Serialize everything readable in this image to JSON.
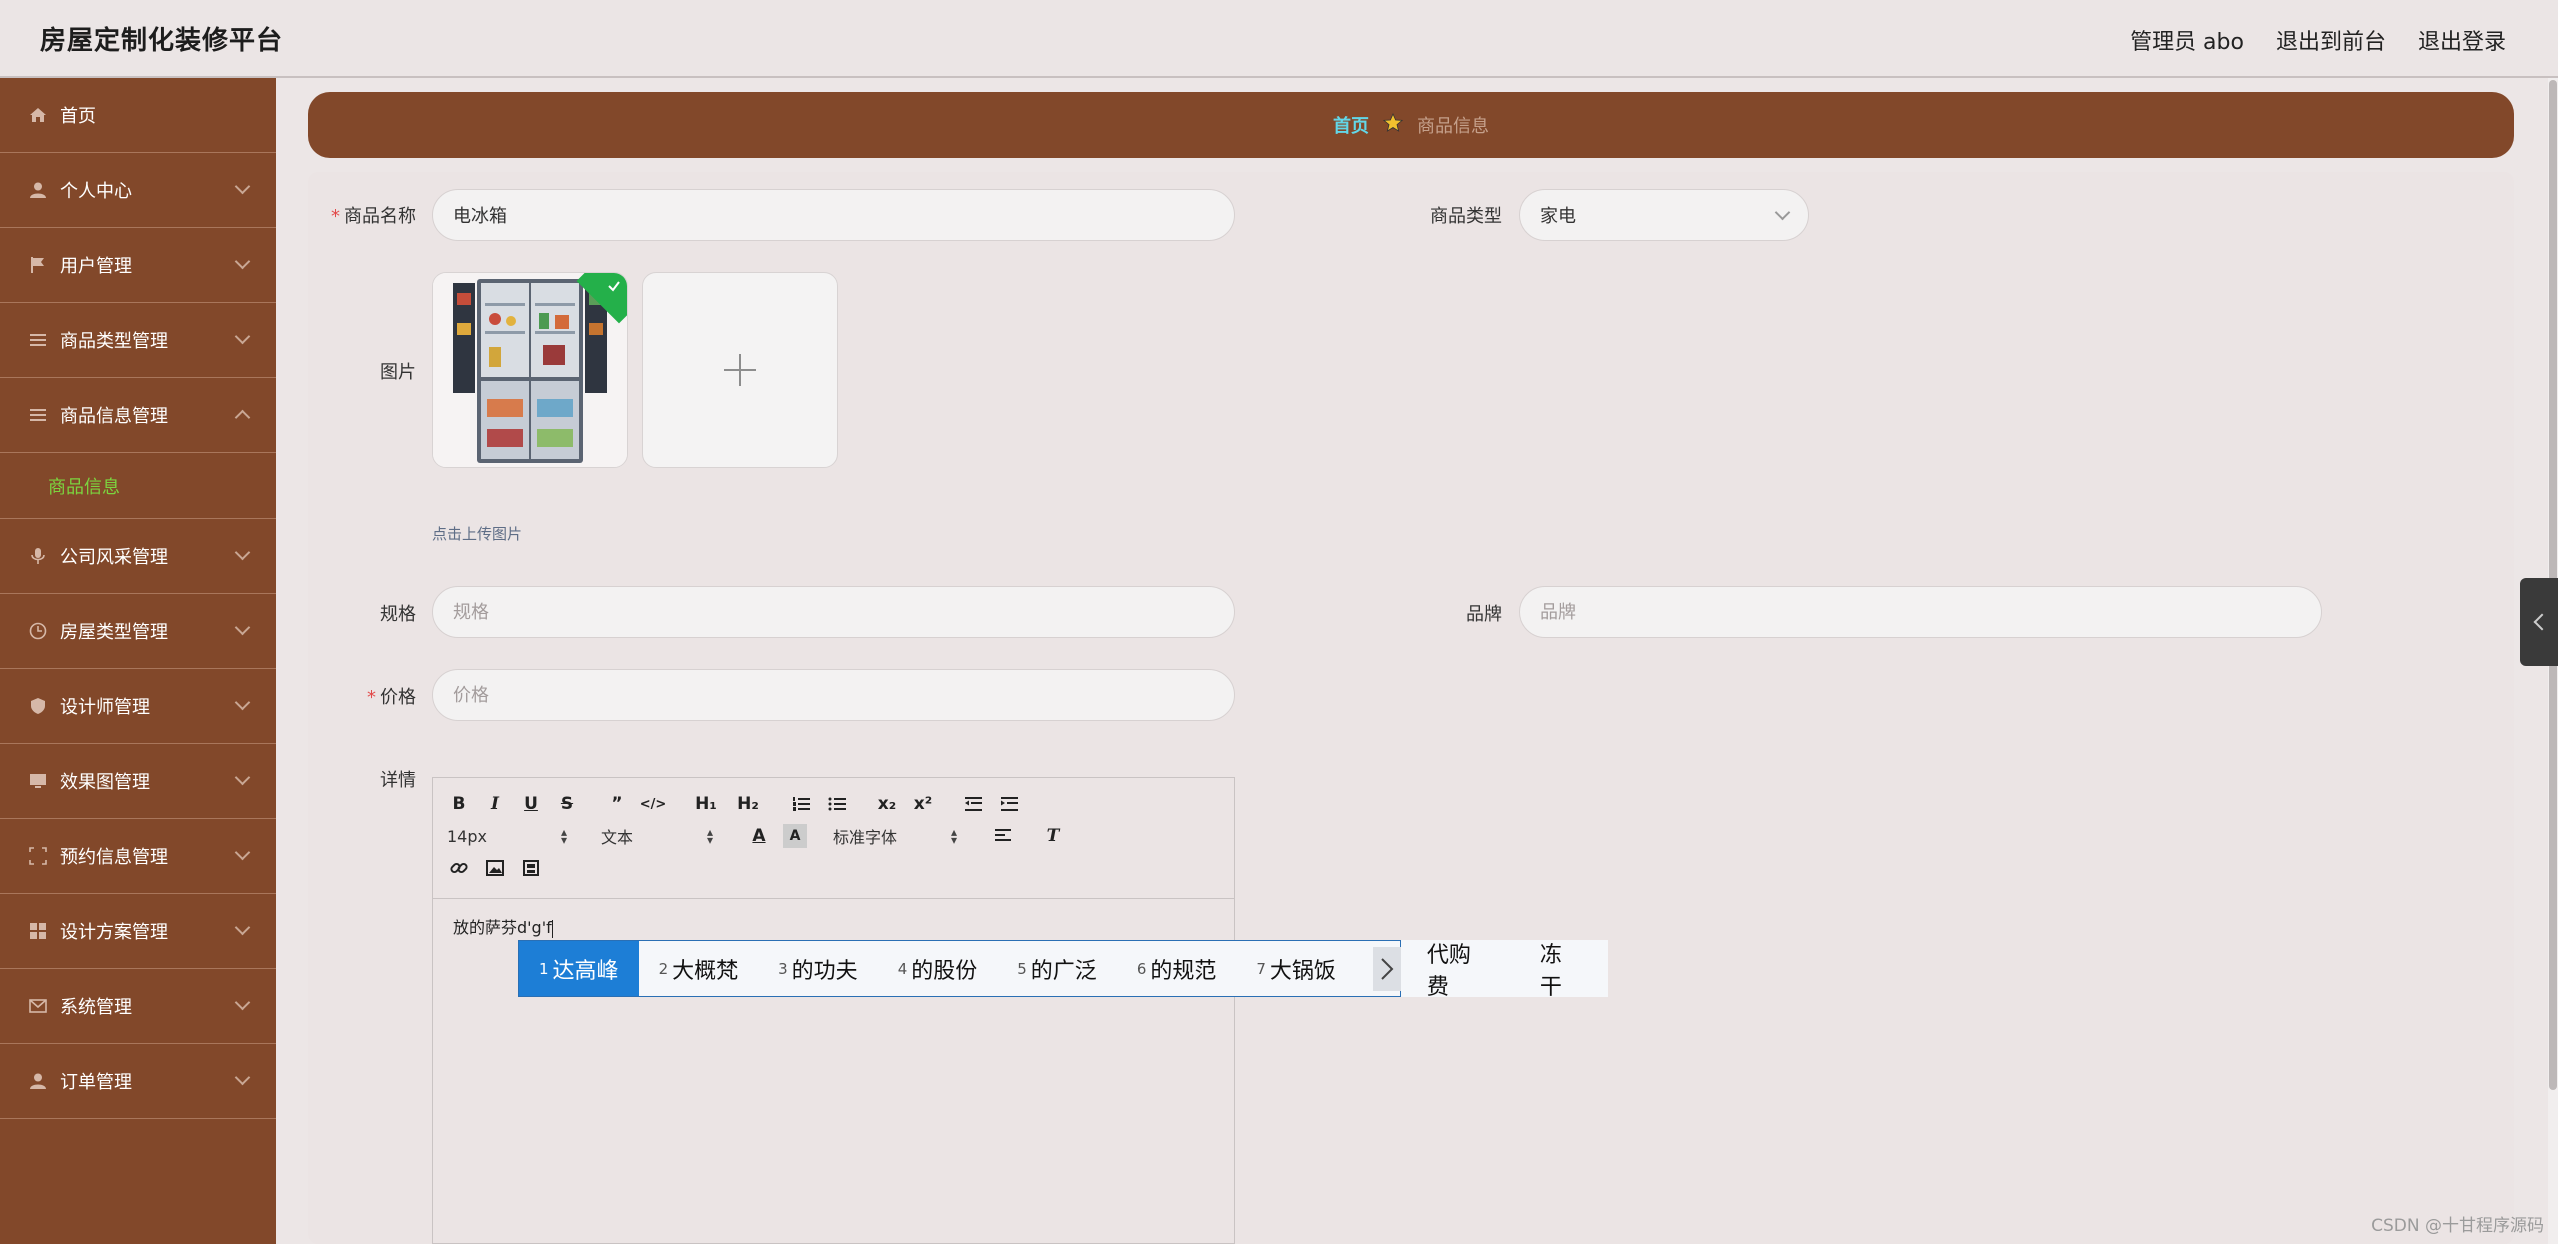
{
  "header": {
    "title": "房屋定制化装修平台",
    "links": [
      "管理员 abo",
      "退出到前台",
      "退出登录"
    ]
  },
  "sidebar": {
    "items": [
      {
        "label": "首页",
        "icon": "home-icon"
      },
      {
        "label": "个人中心",
        "icon": "user-icon"
      },
      {
        "label": "用户管理",
        "icon": "flag-icon"
      },
      {
        "label": "商品类型管理",
        "icon": "list-icon"
      },
      {
        "label": "商品信息管理",
        "icon": "list-icon",
        "expanded": true,
        "sub": "商品信息"
      },
      {
        "label": "公司风采管理",
        "icon": "microphone-icon"
      },
      {
        "label": "房屋类型管理",
        "icon": "clock-icon"
      },
      {
        "label": "设计师管理",
        "icon": "shield-icon"
      },
      {
        "label": "效果图管理",
        "icon": "monitor-icon"
      },
      {
        "label": "预约信息管理",
        "icon": "crop-icon"
      },
      {
        "label": "设计方案管理",
        "icon": "grid-icon"
      },
      {
        "label": "系统管理",
        "icon": "mail-icon"
      },
      {
        "label": "订单管理",
        "icon": "user-icon"
      }
    ]
  },
  "breadcrumb": {
    "home": "首页",
    "current": "商品信息"
  },
  "form": {
    "name_label": "商品名称",
    "name_value": "电冰箱",
    "type_label": "商品类型",
    "type_value": "家电",
    "image_label": "图片",
    "upload_hint": "点击上传图片",
    "spec_label": "规格",
    "spec_placeholder": "规格",
    "brand_label": "品牌",
    "brand_placeholder": "品牌",
    "price_label": "价格",
    "price_placeholder": "价格",
    "detail_label": "详情"
  },
  "editor": {
    "font_size": "14px",
    "block_format": "文本",
    "font_family": "标准字体",
    "content": "放的萨芬d'g'f"
  },
  "ime": {
    "candidates": [
      {
        "n": "1",
        "text": "达高峰"
      },
      {
        "n": "2",
        "text": "大概梵"
      },
      {
        "n": "3",
        "text": "的功夫"
      },
      {
        "n": "4",
        "text": "的股份"
      },
      {
        "n": "5",
        "text": "的广泛"
      },
      {
        "n": "6",
        "text": "的规范"
      },
      {
        "n": "7",
        "text": "大锅饭"
      }
    ],
    "extra": [
      "代购费",
      "冻干"
    ]
  },
  "watermark": "CSDN @十甘程序源码",
  "colors": {
    "sidebar": "#82482a",
    "accent": "#7cd43f",
    "breadcrumb_home": "#62d7e8"
  }
}
